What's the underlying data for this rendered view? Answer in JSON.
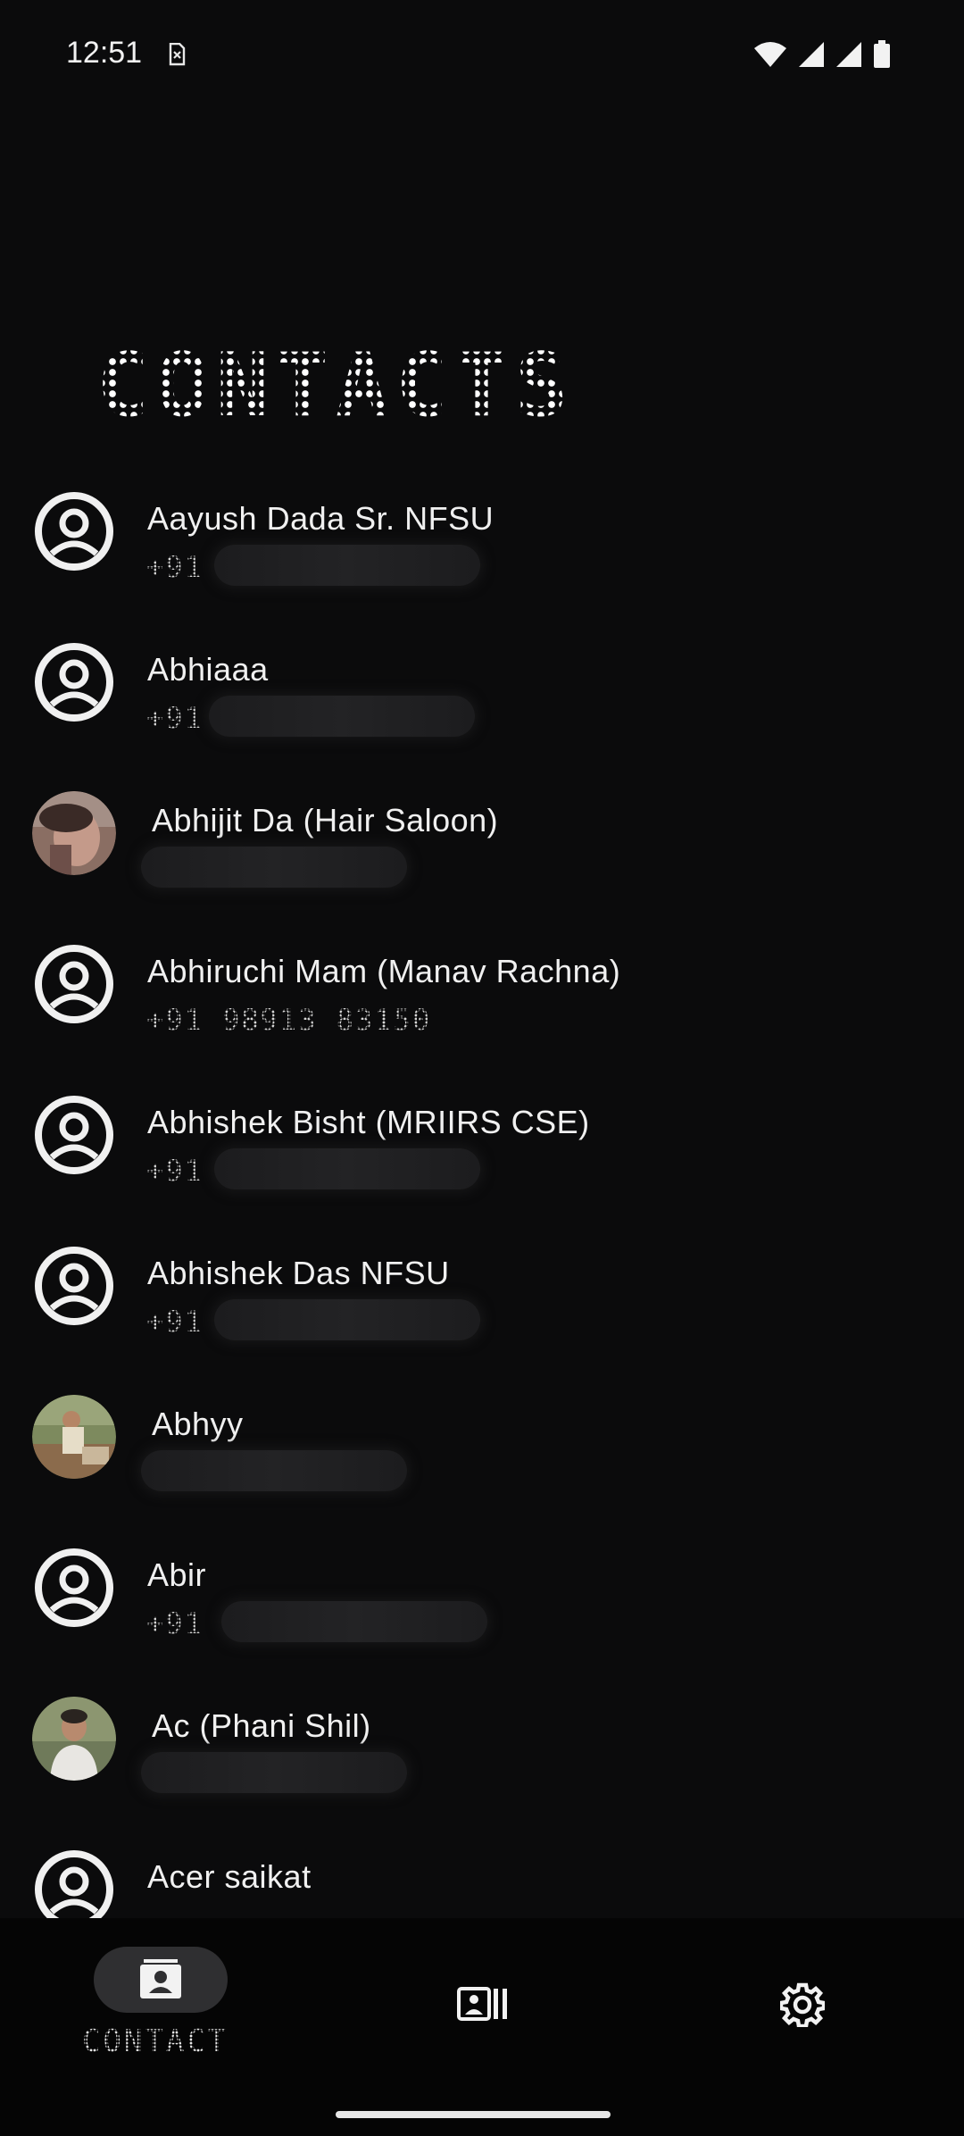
{
  "status_bar": {
    "time": "12:51",
    "icons": [
      "sim-card-icon",
      "wifi-icon",
      "signal-icon",
      "signal-icon",
      "battery-icon"
    ]
  },
  "page": {
    "title": "CONTACTS"
  },
  "contacts": [
    {
      "name": "Aayush Dada Sr. NFSU",
      "phone_prefix": "+91",
      "phone": "",
      "avatar": "default-avatar-icon"
    },
    {
      "name": "Abhiaaa",
      "phone_prefix": "+91",
      "phone": "",
      "avatar": "default-avatar-icon"
    },
    {
      "name": "Abhijit Da (Hair Saloon)",
      "phone_prefix": "",
      "phone": "",
      "avatar": "photo"
    },
    {
      "name": "Abhiruchi Mam (Manav Rachna)",
      "phone_prefix": "",
      "phone": "+91 98913 83150",
      "avatar": "default-avatar-icon"
    },
    {
      "name": "Abhishek Bisht (MRIIRS CSE)",
      "phone_prefix": "+91",
      "phone": "",
      "avatar": "default-avatar-icon"
    },
    {
      "name": "Abhishek Das NFSU",
      "phone_prefix": "+91",
      "phone": "",
      "avatar": "default-avatar-icon"
    },
    {
      "name": "Abhyy",
      "phone_prefix": "",
      "phone": "",
      "avatar": "photo"
    },
    {
      "name": "Abir",
      "phone_prefix": "+91",
      "phone": "",
      "avatar": "default-avatar-icon"
    },
    {
      "name": "Ac (Phani Shil)",
      "phone_prefix": "",
      "phone": "",
      "avatar": "photo"
    },
    {
      "name": "Acer saikat",
      "phone_prefix": "",
      "phone": "",
      "avatar": "default-avatar-icon"
    }
  ],
  "bottom_nav": {
    "items": [
      {
        "icon": "contact-card-icon",
        "label": "CONTACT",
        "selected": true
      },
      {
        "icon": "contacts-list-icon",
        "label": "",
        "selected": false
      },
      {
        "icon": "gear-icon",
        "label": "",
        "selected": false
      }
    ]
  }
}
